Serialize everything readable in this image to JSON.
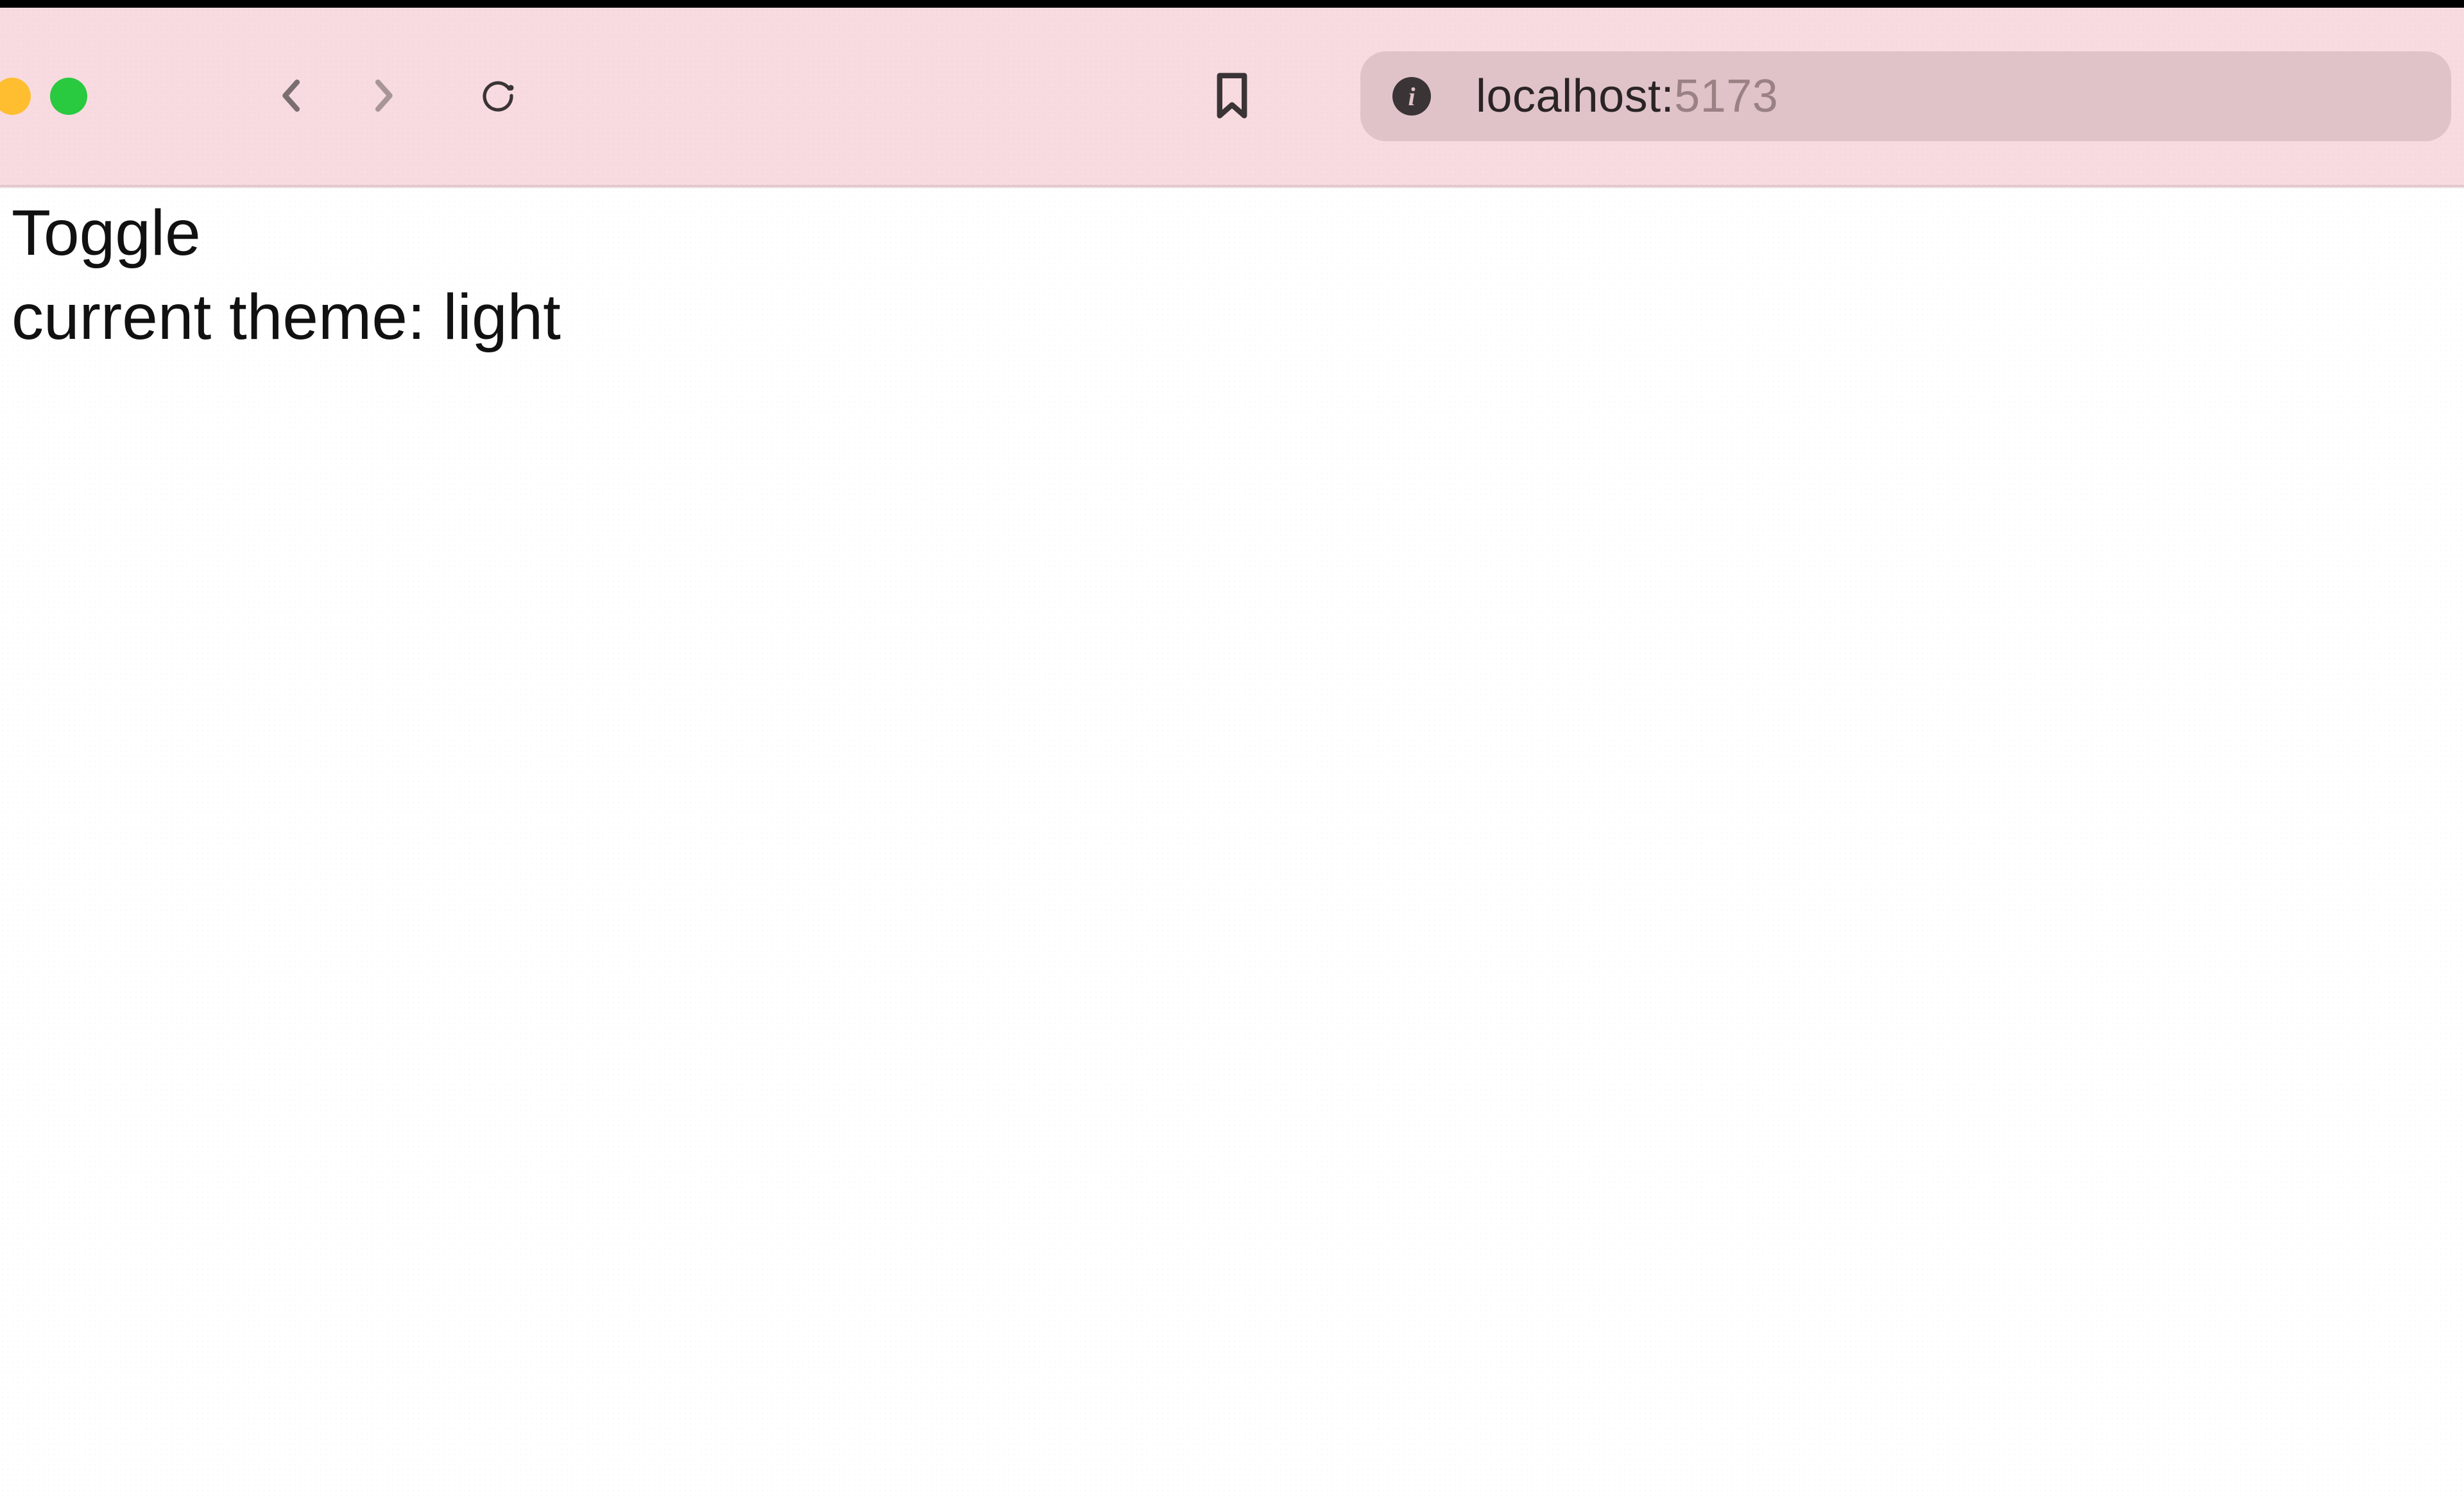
{
  "browser": {
    "url_host": "localhost:",
    "url_port": "5173",
    "site_info_glyph": "i"
  },
  "page": {
    "toggle_label": "Toggle",
    "theme_status": "current theme: light"
  }
}
